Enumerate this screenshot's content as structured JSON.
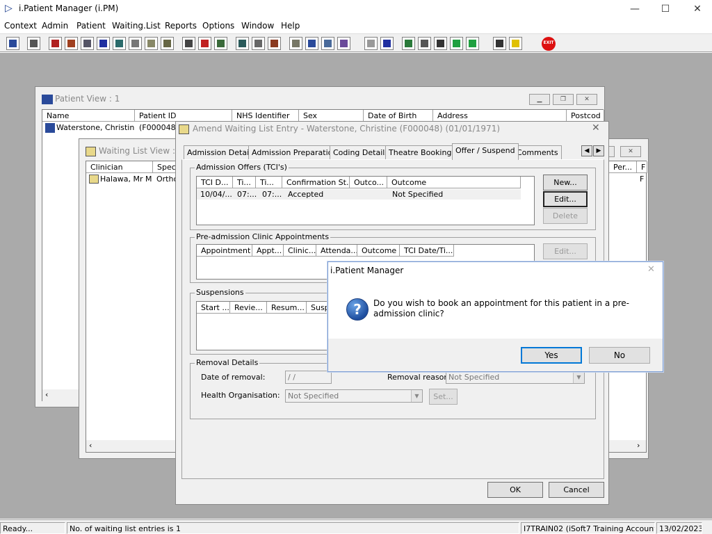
{
  "app": {
    "title": "i.Patient Manager (i.PM)"
  },
  "menu": [
    "Context",
    "Admin",
    "Patient",
    "Waiting.List",
    "Reports",
    "Options",
    "Window",
    "Help"
  ],
  "patient_view": {
    "title": "Patient View : 1",
    "columns": [
      "Name",
      "Patient ID",
      "NHS Identifier",
      "Sex",
      "Date of Birth",
      "Address",
      "Postcod"
    ],
    "row": {
      "name": "Waterstone, Christine...",
      "patient_id": "(F000048)"
    }
  },
  "waiting_list_view": {
    "title": "Waiting List View : 1",
    "columns": [
      "Clinician",
      "Speci",
      "Per...",
      "F"
    ],
    "row": {
      "clinician": "Halawa, Mr M",
      "specialty": "Ortho",
      "last": "F"
    }
  },
  "amend": {
    "title": "Amend Waiting List Entry - Waterstone, Christine (F000048) (01/01/1971)",
    "tabs": [
      "Admission Details",
      "Admission Preparation",
      "Coding Details",
      "Theatre Bookings",
      "Offer / Suspend",
      "Comments"
    ],
    "active_tab": "Offer / Suspend",
    "admission_offers": {
      "label": "Admission Offers (TCI's)",
      "columns": [
        "TCI D...",
        "Ti...",
        "Ti...",
        "Confirmation St...",
        "Outco...",
        "Outcome"
      ],
      "rows": [
        [
          "10/04/...",
          "07:...",
          "07:...",
          "Accepted",
          "",
          "Not Specified"
        ]
      ],
      "buttons": {
        "new": "New...",
        "edit": "Edit...",
        "delete": "Delete"
      }
    },
    "preadmission": {
      "label": "Pre-admission Clinic Appointments",
      "columns": [
        "Appointment",
        "Appt...",
        "Clinic...",
        "Attenda...",
        "Outcome",
        "TCI Date/Ti..."
      ],
      "edit": "Edit..."
    },
    "suspensions": {
      "label": "Suspensions",
      "columns": [
        "Start ...",
        "Revie...",
        "Resum...",
        "Susp"
      ]
    },
    "removal": {
      "label": "Removal Details",
      "date_label": "Date of removal:",
      "date_value": " /  /",
      "reason_label": "Removal reason:",
      "reason_value": "Not Specified",
      "org_label": "Health Organisation:",
      "org_value": "Not Specified",
      "set": "Set..."
    },
    "ok": "OK",
    "cancel": "Cancel"
  },
  "dialog": {
    "title": "i.Patient Manager",
    "message": "Do you wish to book an appointment for this patient in a pre-admission clinic?",
    "yes": "Yes",
    "no": "No"
  },
  "status": {
    "ready": "Ready...",
    "entries": "No. of waiting list entries is 1",
    "user": "I7TRAIN02 (iSoft7 Training Account)",
    "date": "13/02/2023"
  },
  "toolbar_icons": [
    "patient-icon",
    "print-icon",
    "book-icon",
    "folder-icon",
    "form-icon",
    "m-icon",
    "person-icon",
    "notes-icon",
    "referral-icon",
    "transport-icon",
    "find-icon",
    "clock-icon",
    "list-icon",
    "chart-icon",
    "doc-icon",
    "dial-icon",
    "letter-icon",
    "waiting-icon",
    "ward-icon",
    "bed-icon",
    "page-icon",
    "bar-chart-icon",
    "globe-icon",
    "mail-icon",
    "check-icon",
    "import-icon",
    "export-icon",
    "transfer-icon",
    "warning-icon",
    "exit-icon"
  ],
  "colors": {
    "workspace": "#aaaaaa",
    "dialog_border": "#7a9cd3",
    "exit": "#dd1111"
  }
}
